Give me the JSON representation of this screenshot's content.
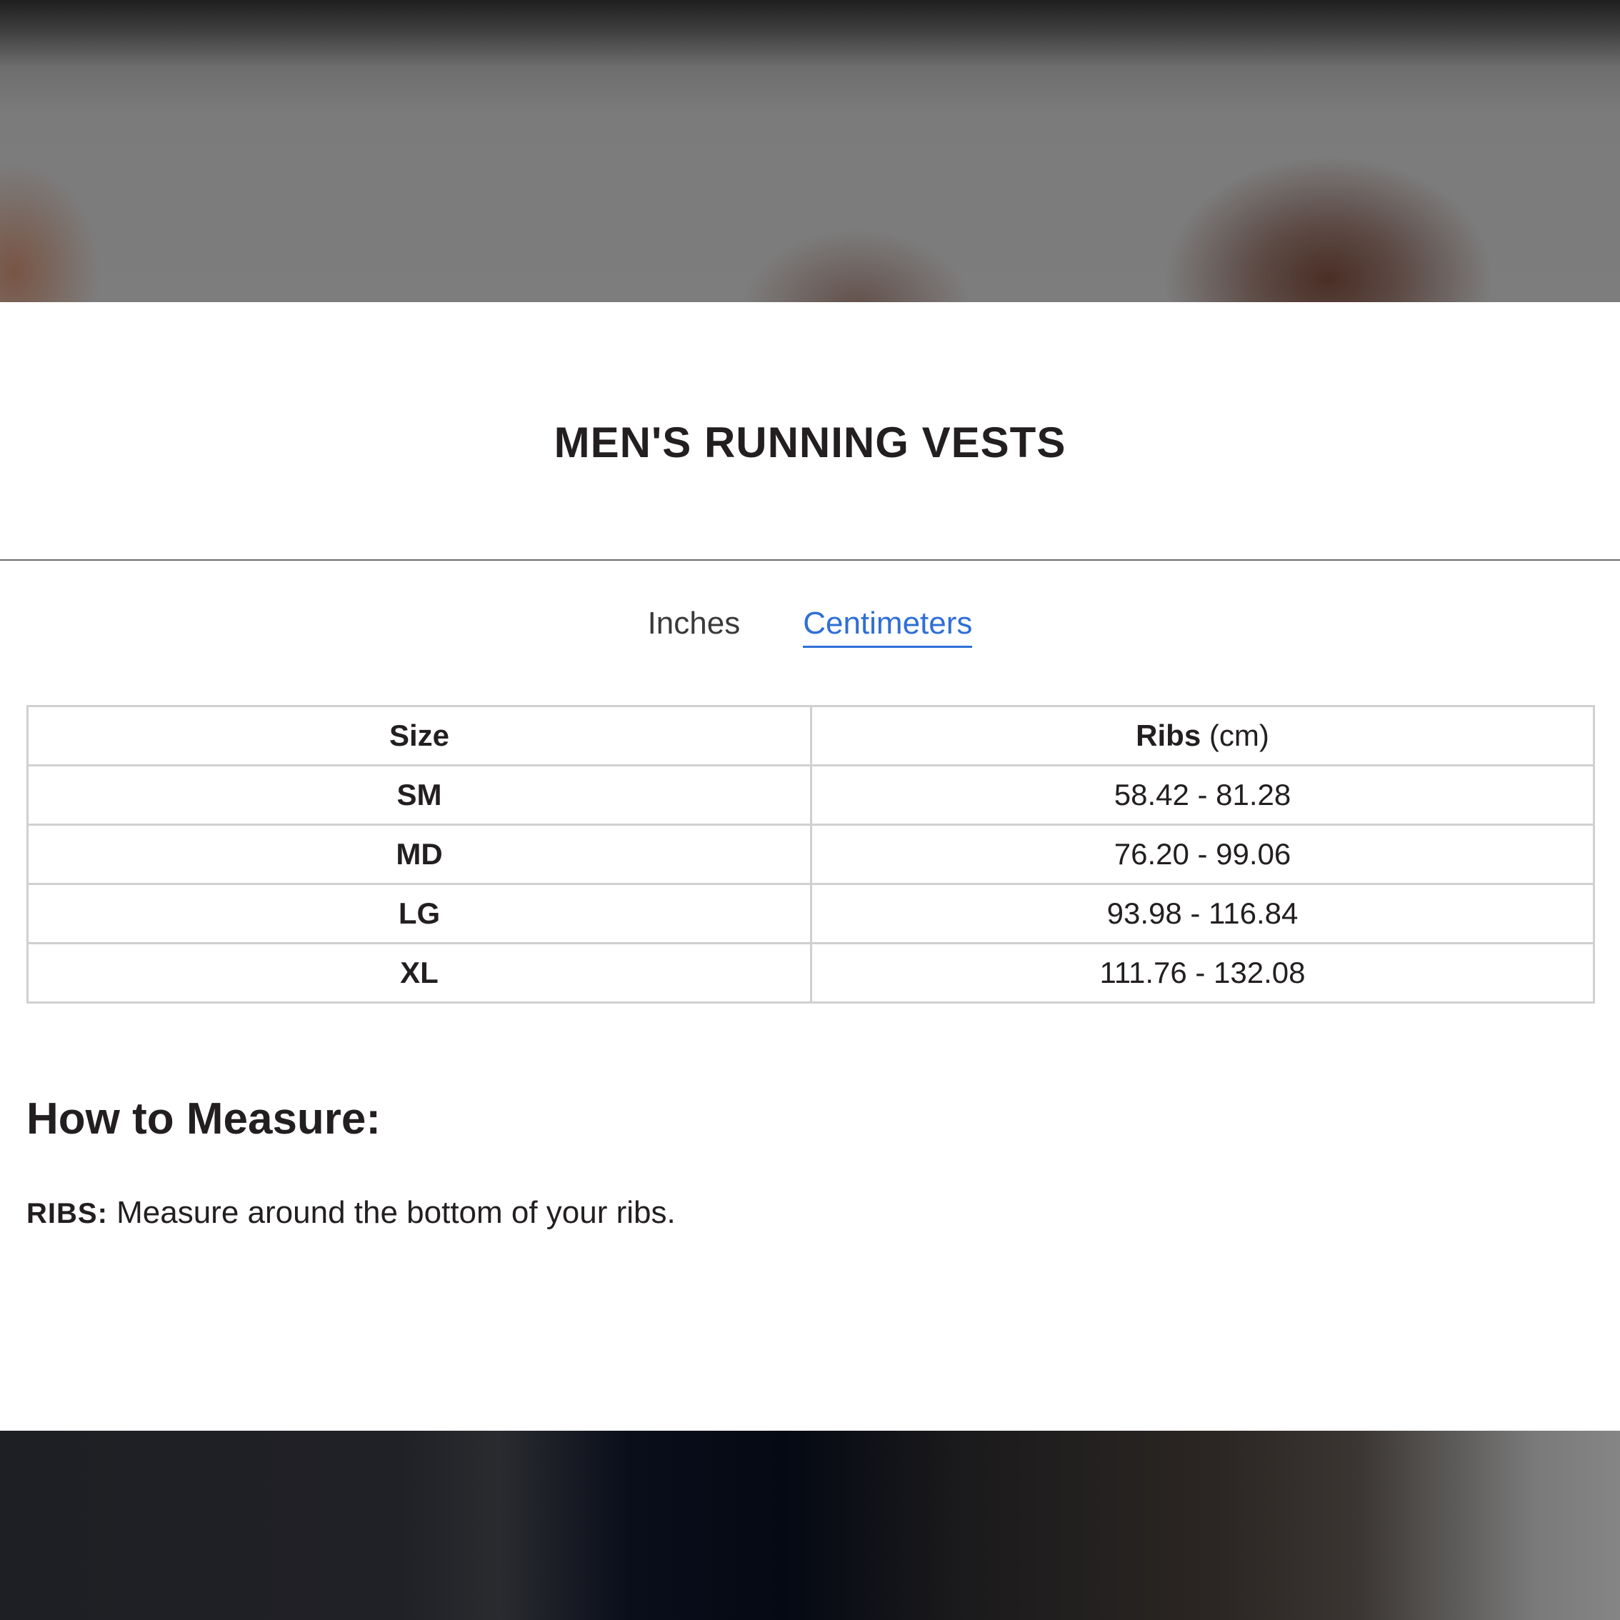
{
  "page": {
    "title": "MEN'S RUNNING VESTS"
  },
  "unit_tabs": {
    "items": [
      {
        "label": "Inches",
        "active": false
      },
      {
        "label": "Centimeters",
        "active": true
      }
    ],
    "active_color": "#2f6fd6"
  },
  "size_table": {
    "headers": {
      "size": "Size",
      "ribs": "Ribs",
      "ribs_unit": "(cm)"
    },
    "rows": [
      {
        "size": "SM",
        "ribs": "58.42 - 81.28"
      },
      {
        "size": "MD",
        "ribs": "76.20 - 99.06"
      },
      {
        "size": "LG",
        "ribs": "93.98 - 116.84"
      },
      {
        "size": "XL",
        "ribs": "111.76 - 132.08"
      }
    ]
  },
  "how_to_measure": {
    "heading": "How to Measure:",
    "items": [
      {
        "term": "RIBS:",
        "description": " Measure around the bottom of your ribs."
      }
    ]
  }
}
